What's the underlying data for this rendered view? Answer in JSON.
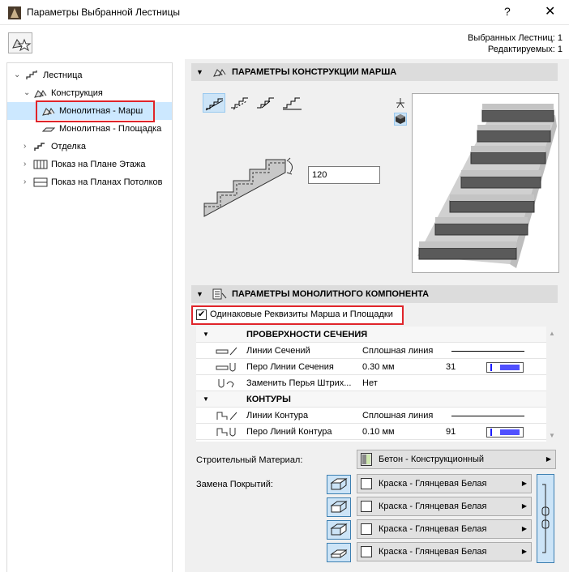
{
  "window": {
    "title": "Параметры Выбранной Лестницы",
    "help": "?",
    "close": "✕"
  },
  "selection": {
    "selected": "Выбранных Лестниц: 1",
    "editable": "Редактируемых: 1"
  },
  "tree": {
    "items": [
      {
        "label": "Лестница"
      },
      {
        "label": "Конструкция"
      },
      {
        "label": "Монолитная - Марш"
      },
      {
        "label": "Монолитная - Площадка"
      },
      {
        "label": "Отделка"
      },
      {
        "label": "Показ на Плане Этажа"
      },
      {
        "label": "Показ на Планах Потолков"
      }
    ]
  },
  "section1": {
    "title": "ПАРАМЕТРЫ КОНСТРУКЦИИ МАРША",
    "thickness_value": "120"
  },
  "section2": {
    "title": "ПАРАМЕТРЫ МОНОЛИТНОГО КОМПОНЕНТА",
    "checkbox_label": "Одинаковые Реквизиты Марша и Площадки"
  },
  "grid": {
    "group1": "ПРОВЕРХНОСТИ СЕЧЕНИЯ",
    "row1": {
      "label": "Линии Сечений",
      "value": "Сплошная линия"
    },
    "row2": {
      "label": "Перо Линии Сечения",
      "value": "0.30 мм",
      "num": "31"
    },
    "row3": {
      "label": "Заменить Перья Штрих...",
      "value": "Нет"
    },
    "group2": "КОНТУРЫ",
    "row4": {
      "label": "Линии Контура",
      "value": "Сплошная линия"
    },
    "row5": {
      "label": "Перо Линий Контура",
      "value": "0.10 мм",
      "num": "91"
    }
  },
  "material": {
    "label": "Строительный Материал:",
    "value": "Бетон - Конструкционный"
  },
  "override": {
    "label": "Замена Покрытий:",
    "surfaces": [
      "Краска - Глянцевая Белая",
      "Краска - Глянцевая Белая",
      "Краска - Глянцевая Белая",
      "Краска - Глянцевая Белая"
    ]
  },
  "colors": {
    "accent": "#cce4f7",
    "highlight": "#e0242a",
    "pen": "#5050ff"
  }
}
